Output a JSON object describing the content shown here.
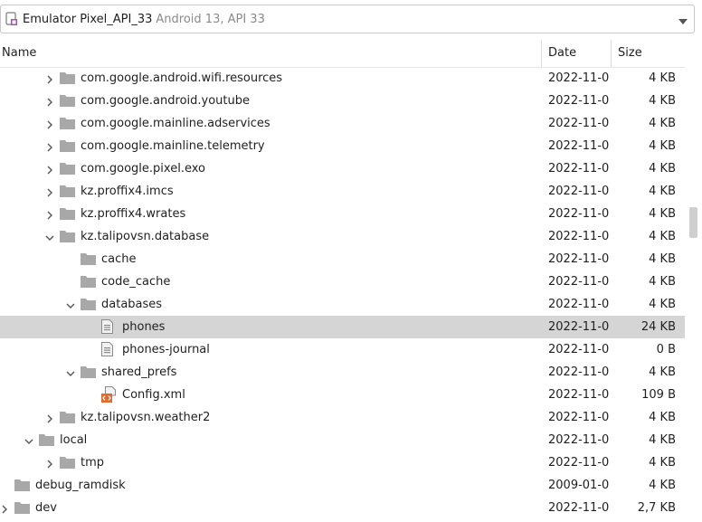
{
  "device_selector": {
    "device_name": "Emulator Pixel_API_33",
    "device_detail": "Android 13, API 33"
  },
  "columns": {
    "name": "Name",
    "date": "Date",
    "size": "Size"
  },
  "rows": [
    {
      "name": "com.google.android.wifi.resources",
      "date": "2022-11-0",
      "size": "4 KB",
      "kind": "folder",
      "level": 2,
      "toggle": "collapsed"
    },
    {
      "name": "com.google.android.youtube",
      "date": "2022-11-0",
      "size": "4 KB",
      "kind": "folder",
      "level": 2,
      "toggle": "collapsed"
    },
    {
      "name": "com.google.mainline.adservices",
      "date": "2022-11-0",
      "size": "4 KB",
      "kind": "folder",
      "level": 2,
      "toggle": "collapsed"
    },
    {
      "name": "com.google.mainline.telemetry",
      "date": "2022-11-0",
      "size": "4 KB",
      "kind": "folder",
      "level": 2,
      "toggle": "collapsed"
    },
    {
      "name": "com.google.pixel.exo",
      "date": "2022-11-0",
      "size": "4 KB",
      "kind": "folder",
      "level": 2,
      "toggle": "collapsed"
    },
    {
      "name": "kz.proffix4.imcs",
      "date": "2022-11-0",
      "size": "4 KB",
      "kind": "folder",
      "level": 2,
      "toggle": "collapsed"
    },
    {
      "name": "kz.proffix4.wrates",
      "date": "2022-11-0",
      "size": "4 KB",
      "kind": "folder",
      "level": 2,
      "toggle": "collapsed"
    },
    {
      "name": "kz.talipovsn.database",
      "date": "2022-11-0",
      "size": "4 KB",
      "kind": "folder",
      "level": 2,
      "toggle": "expanded"
    },
    {
      "name": "cache",
      "date": "2022-11-0",
      "size": "4 KB",
      "kind": "folder",
      "level": 3,
      "toggle": "none"
    },
    {
      "name": "code_cache",
      "date": "2022-11-0",
      "size": "4 KB",
      "kind": "folder",
      "level": 3,
      "toggle": "none"
    },
    {
      "name": "databases",
      "date": "2022-11-0",
      "size": "4 KB",
      "kind": "folder",
      "level": 3,
      "toggle": "expanded"
    },
    {
      "name": "phones",
      "date": "2022-11-0",
      "size": "24 KB",
      "kind": "file",
      "level": 4,
      "toggle": "none",
      "selected": true
    },
    {
      "name": "phones-journal",
      "date": "2022-11-0",
      "size": "0 B",
      "kind": "file",
      "level": 4,
      "toggle": "none"
    },
    {
      "name": "shared_prefs",
      "date": "2022-11-0",
      "size": "4 KB",
      "kind": "folder",
      "level": 3,
      "toggle": "expanded"
    },
    {
      "name": "Config.xml",
      "date": "2022-11-0",
      "size": "109 B",
      "kind": "xml",
      "level": 4,
      "toggle": "none"
    },
    {
      "name": "kz.talipovsn.weather2",
      "date": "2022-11-0",
      "size": "4 KB",
      "kind": "folder",
      "level": 2,
      "toggle": "collapsed"
    },
    {
      "name": "local",
      "date": "2022-11-0",
      "size": "4 KB",
      "kind": "folder",
      "level": 1,
      "toggle": "expanded"
    },
    {
      "name": "tmp",
      "date": "2022-11-0",
      "size": "4 KB",
      "kind": "folder",
      "level": 2,
      "toggle": "collapsed"
    },
    {
      "name": "debug_ramdisk",
      "date": "2009-01-0",
      "size": "4 KB",
      "kind": "folder",
      "level": 0,
      "toggle": "none"
    },
    {
      "name": "dev",
      "date": "2022-11-0",
      "size": "2,7 KB",
      "kind": "folder",
      "level": 0,
      "toggle": "collapsed"
    },
    {
      "name": "",
      "date": "",
      "size": "",
      "kind": "folder",
      "level": 0,
      "toggle": "none"
    }
  ],
  "colors": {
    "selected_row": "#d5d5d5",
    "folder": "#a8a8a8",
    "xml_badge": "#e26a2c"
  }
}
